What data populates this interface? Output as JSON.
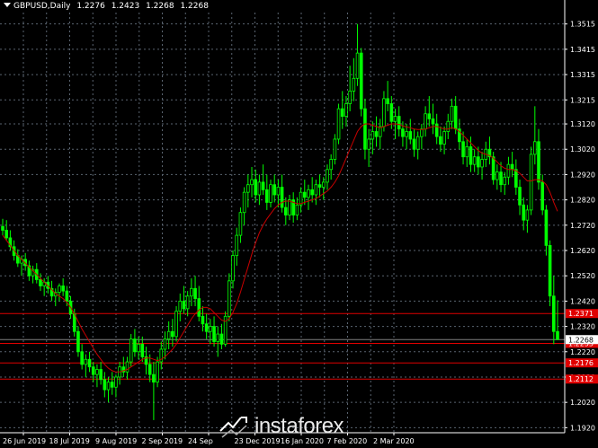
{
  "header": {
    "symbol": "GBPUSD,Daily",
    "open": "1.2276",
    "high": "1.2423",
    "low": "1.2268",
    "close": "1.2268"
  },
  "watermark": {
    "text": "instaforex"
  },
  "chart_data": {
    "type": "candlestick",
    "y_ticks": [
      "1.3515",
      "1.3415",
      "1.3315",
      "1.3215",
      "1.3120",
      "1.3020",
      "1.2920",
      "1.2820",
      "1.2720",
      "1.2620",
      "1.2520",
      "1.2420",
      "1.2320",
      "1.2220",
      "1.2120",
      "1.2020",
      "1.1920"
    ],
    "x_ticks": [
      "26 Jun 2019",
      "18 Jul 2019",
      "9 Aug 2019",
      "2 Sep 2019",
      "24 Sep",
      "23 Dec 2019",
      "16 Jan 2020",
      "7 Feb 2020",
      "2 Mar 2020"
    ],
    "ylim": [
      1.19,
      1.356
    ],
    "levels": [
      {
        "value": 1.2371,
        "label": "1.2371",
        "color": "#e00000"
      },
      {
        "value": 1.2253,
        "label": "1.2253",
        "color": "#e00000"
      },
      {
        "value": 1.2176,
        "label": "1.2176",
        "color": "#e00000"
      },
      {
        "value": 1.2112,
        "label": "1.2112",
        "color": "#e00000"
      }
    ],
    "current_price": {
      "value": 1.2268,
      "label": "1.2268"
    },
    "grid": true,
    "colors": {
      "up": "#00ff00",
      "down": "#00ff00",
      "ma": "#c80000",
      "grid": "#5a6470",
      "level": "#e00000"
    },
    "series": [
      {
        "type": "ohlc",
        "values": [
          [
            1.2715,
            1.2745,
            1.268,
            1.27
          ],
          [
            1.27,
            1.274,
            1.266,
            1.267
          ],
          [
            1.267,
            1.27,
            1.262,
            1.2635
          ],
          [
            1.2635,
            1.266,
            1.258,
            1.26
          ],
          [
            1.26,
            1.2625,
            1.2555,
            1.257
          ],
          [
            1.257,
            1.26,
            1.252,
            1.2585
          ],
          [
            1.2585,
            1.261,
            1.254,
            1.256
          ],
          [
            1.256,
            1.258,
            1.25,
            1.252
          ],
          [
            1.252,
            1.256,
            1.249,
            1.2545
          ],
          [
            1.2545,
            1.257,
            1.249,
            1.2505
          ],
          [
            1.2505,
            1.253,
            1.246,
            1.248
          ],
          [
            1.248,
            1.251,
            1.244,
            1.2495
          ],
          [
            1.2495,
            1.252,
            1.245,
            1.247
          ],
          [
            1.247,
            1.25,
            1.242,
            1.244
          ],
          [
            1.244,
            1.247,
            1.24,
            1.2455
          ],
          [
            1.2455,
            1.249,
            1.242,
            1.248
          ],
          [
            1.248,
            1.251,
            1.244,
            1.246
          ],
          [
            1.246,
            1.248,
            1.24,
            1.242
          ],
          [
            1.242,
            1.244,
            1.235,
            1.237
          ],
          [
            1.237,
            1.239,
            1.228,
            1.23
          ],
          [
            1.23,
            1.232,
            1.22,
            1.222
          ],
          [
            1.222,
            1.225,
            1.215,
            1.217
          ],
          [
            1.217,
            1.221,
            1.212,
            1.219
          ],
          [
            1.219,
            1.222,
            1.214,
            1.216
          ],
          [
            1.216,
            1.218,
            1.21,
            1.213
          ],
          [
            1.213,
            1.217,
            1.208,
            1.215
          ],
          [
            1.215,
            1.218,
            1.209,
            1.211
          ],
          [
            1.211,
            1.214,
            1.204,
            1.207
          ],
          [
            1.207,
            1.212,
            1.202,
            1.21
          ],
          [
            1.21,
            1.214,
            1.205,
            1.208
          ],
          [
            1.208,
            1.213,
            1.204,
            1.212
          ],
          [
            1.212,
            1.218,
            1.209,
            1.216
          ],
          [
            1.216,
            1.22,
            1.212,
            1.214
          ],
          [
            1.214,
            1.22,
            1.211,
            1.218
          ],
          [
            1.218,
            1.229,
            1.216,
            1.227
          ],
          [
            1.227,
            1.231,
            1.22,
            1.222
          ],
          [
            1.222,
            1.228,
            1.219,
            1.225
          ],
          [
            1.225,
            1.228,
            1.218,
            1.22
          ],
          [
            1.22,
            1.224,
            1.213,
            1.217
          ],
          [
            1.217,
            1.221,
            1.21,
            1.213
          ],
          [
            1.213,
            1.218,
            1.195,
            1.21
          ],
          [
            1.21,
            1.22,
            1.208,
            1.218
          ],
          [
            1.218,
            1.226,
            1.215,
            1.223
          ],
          [
            1.223,
            1.23,
            1.219,
            1.227
          ],
          [
            1.227,
            1.234,
            1.223,
            1.23
          ],
          [
            1.23,
            1.235,
            1.224,
            1.228
          ],
          [
            1.228,
            1.24,
            1.226,
            1.238
          ],
          [
            1.238,
            1.245,
            1.234,
            1.242
          ],
          [
            1.242,
            1.248,
            1.237,
            1.239
          ],
          [
            1.239,
            1.246,
            1.236,
            1.244
          ],
          [
            1.244,
            1.251,
            1.24,
            1.247
          ],
          [
            1.247,
            1.252,
            1.24,
            1.243
          ],
          [
            1.243,
            1.248,
            1.234,
            1.236
          ],
          [
            1.236,
            1.24,
            1.23,
            1.233
          ],
          [
            1.233,
            1.237,
            1.227,
            1.23
          ],
          [
            1.23,
            1.235,
            1.225,
            1.232
          ],
          [
            1.232,
            1.236,
            1.224,
            1.226
          ],
          [
            1.226,
            1.232,
            1.22,
            1.229
          ],
          [
            1.229,
            1.233,
            1.223,
            1.225
          ],
          [
            1.225,
            1.238,
            1.224,
            1.236
          ],
          [
            1.236,
            1.253,
            1.234,
            1.25
          ],
          [
            1.25,
            1.262,
            1.247,
            1.26
          ],
          [
            1.26,
            1.271,
            1.256,
            1.268
          ],
          [
            1.268,
            1.279,
            1.265,
            1.277
          ],
          [
            1.277,
            1.287,
            1.272,
            1.285
          ],
          [
            1.285,
            1.292,
            1.279,
            1.288
          ],
          [
            1.288,
            1.295,
            1.283,
            1.29
          ],
          [
            1.29,
            1.294,
            1.281,
            1.284
          ],
          [
            1.284,
            1.292,
            1.28,
            1.289
          ],
          [
            1.289,
            1.296,
            1.284,
            1.286
          ],
          [
            1.286,
            1.292,
            1.278,
            1.281
          ],
          [
            1.281,
            1.29,
            1.279,
            1.288
          ],
          [
            1.288,
            1.292,
            1.281,
            1.284
          ],
          [
            1.284,
            1.29,
            1.279,
            1.287
          ],
          [
            1.287,
            1.292,
            1.277,
            1.279
          ],
          [
            1.279,
            1.283,
            1.272,
            1.276
          ],
          [
            1.276,
            1.284,
            1.274,
            1.282
          ],
          [
            1.282,
            1.285,
            1.273,
            1.276
          ],
          [
            1.276,
            1.283,
            1.274,
            1.28
          ],
          [
            1.28,
            1.287,
            1.277,
            1.285
          ],
          [
            1.285,
            1.29,
            1.28,
            1.283
          ],
          [
            1.283,
            1.288,
            1.278,
            1.286
          ],
          [
            1.286,
            1.291,
            1.281,
            1.284
          ],
          [
            1.284,
            1.29,
            1.28,
            1.288
          ],
          [
            1.288,
            1.292,
            1.283,
            1.287
          ],
          [
            1.287,
            1.291,
            1.282,
            1.289
          ],
          [
            1.289,
            1.296,
            1.286,
            1.294
          ],
          [
            1.294,
            1.3,
            1.29,
            1.298
          ],
          [
            1.298,
            1.308,
            1.296,
            1.306
          ],
          [
            1.306,
            1.32,
            1.304,
            1.318
          ],
          [
            1.318,
            1.325,
            1.31,
            1.315
          ],
          [
            1.315,
            1.323,
            1.311,
            1.32
          ],
          [
            1.32,
            1.335,
            1.317,
            1.325
          ],
          [
            1.325,
            1.338,
            1.321,
            1.33
          ],
          [
            1.33,
            1.3515,
            1.327,
            1.34
          ],
          [
            1.34,
            1.342,
            1.315,
            1.318
          ],
          [
            1.318,
            1.322,
            1.298,
            1.302
          ],
          [
            1.302,
            1.31,
            1.295,
            1.306
          ],
          [
            1.306,
            1.313,
            1.3,
            1.309
          ],
          [
            1.309,
            1.315,
            1.303,
            1.307
          ],
          [
            1.307,
            1.314,
            1.302,
            1.311
          ],
          [
            1.311,
            1.325,
            1.309,
            1.322
          ],
          [
            1.322,
            1.329,
            1.317,
            1.32
          ],
          [
            1.32,
            1.323,
            1.31,
            1.313
          ],
          [
            1.313,
            1.318,
            1.306,
            1.315
          ],
          [
            1.315,
            1.319,
            1.307,
            1.31
          ],
          [
            1.31,
            1.313,
            1.303,
            1.307
          ],
          [
            1.307,
            1.312,
            1.302,
            1.309
          ],
          [
            1.309,
            1.314,
            1.304,
            1.306
          ],
          [
            1.306,
            1.31,
            1.299,
            1.302
          ],
          [
            1.302,
            1.309,
            1.298,
            1.307
          ],
          [
            1.307,
            1.312,
            1.302,
            1.31
          ],
          [
            1.31,
            1.319,
            1.307,
            1.316
          ],
          [
            1.316,
            1.323,
            1.311,
            1.314
          ],
          [
            1.314,
            1.32,
            1.308,
            1.312
          ],
          [
            1.312,
            1.316,
            1.304,
            1.307
          ],
          [
            1.307,
            1.311,
            1.301,
            1.304
          ],
          [
            1.304,
            1.311,
            1.3,
            1.309
          ],
          [
            1.309,
            1.316,
            1.306,
            1.313
          ],
          [
            1.313,
            1.322,
            1.31,
            1.319
          ],
          [
            1.319,
            1.323,
            1.308,
            1.31
          ],
          [
            1.31,
            1.314,
            1.302,
            1.305
          ],
          [
            1.305,
            1.309,
            1.296,
            1.299
          ],
          [
            1.299,
            1.306,
            1.295,
            1.303
          ],
          [
            1.303,
            1.307,
            1.293,
            1.296
          ],
          [
            1.296,
            1.302,
            1.293,
            1.299
          ],
          [
            1.299,
            1.303,
            1.292,
            1.295
          ],
          [
            1.295,
            1.301,
            1.29,
            1.298
          ],
          [
            1.298,
            1.305,
            1.295,
            1.302
          ],
          [
            1.302,
            1.307,
            1.296,
            1.299
          ],
          [
            1.299,
            1.301,
            1.288,
            1.29
          ],
          [
            1.29,
            1.296,
            1.286,
            1.293
          ],
          [
            1.293,
            1.297,
            1.285,
            1.288
          ],
          [
            1.288,
            1.293,
            1.284,
            1.291
          ],
          [
            1.291,
            1.299,
            1.288,
            1.296
          ],
          [
            1.296,
            1.301,
            1.291,
            1.294
          ],
          [
            1.294,
            1.298,
            1.284,
            1.287
          ],
          [
            1.287,
            1.29,
            1.276,
            1.28
          ],
          [
            1.28,
            1.283,
            1.27,
            1.274
          ],
          [
            1.274,
            1.28,
            1.269,
            1.278
          ],
          [
            1.278,
            1.303,
            1.276,
            1.3
          ],
          [
            1.3,
            1.319,
            1.296,
            1.305
          ],
          [
            1.305,
            1.31,
            1.286,
            1.289
          ],
          [
            1.289,
            1.292,
            1.276,
            1.278
          ],
          [
            1.278,
            1.28,
            1.26,
            1.264
          ],
          [
            1.264,
            1.266,
            1.24,
            1.244
          ],
          [
            1.244,
            1.252,
            1.225,
            1.23
          ],
          [
            1.23,
            1.2423,
            1.2268,
            1.2268
          ]
        ]
      },
      {
        "type": "ma",
        "values": [
          1.268,
          1.266,
          1.264,
          1.262,
          1.26,
          1.2585,
          1.257,
          1.2555,
          1.254,
          1.2525,
          1.251,
          1.2495,
          1.248,
          1.2465,
          1.245,
          1.244,
          1.243,
          1.2415,
          1.2395,
          1.237,
          1.234,
          1.231,
          1.2285,
          1.226,
          1.2235,
          1.221,
          1.219,
          1.217,
          1.2155,
          1.2145,
          1.214,
          1.214,
          1.2145,
          1.215,
          1.216,
          1.217,
          1.218,
          1.219,
          1.2195,
          1.2195,
          1.219,
          1.2185,
          1.219,
          1.22,
          1.2215,
          1.223,
          1.225,
          1.2275,
          1.23,
          1.2325,
          1.235,
          1.237,
          1.2385,
          1.2395,
          1.2395,
          1.239,
          1.2375,
          1.236,
          1.2345,
          1.234,
          1.235,
          1.2375,
          1.241,
          1.2455,
          1.2505,
          1.2555,
          1.2605,
          1.265,
          1.269,
          1.272,
          1.2745,
          1.2765,
          1.2785,
          1.28,
          1.281,
          1.2815,
          1.2815,
          1.281,
          1.2805,
          1.2805,
          1.281,
          1.2815,
          1.282,
          1.2825,
          1.2835,
          1.2845,
          1.2855,
          1.287,
          1.289,
          1.2915,
          1.295,
          1.2985,
          1.302,
          1.3055,
          1.309,
          1.311,
          1.312,
          1.312,
          1.3115,
          1.311,
          1.3105,
          1.311,
          1.3115,
          1.312,
          1.312,
          1.3118,
          1.3112,
          1.3108,
          1.3105,
          1.31,
          1.3098,
          1.3098,
          1.31,
          1.3105,
          1.311,
          1.311,
          1.3105,
          1.31,
          1.31,
          1.3105,
          1.31,
          1.309,
          1.3075,
          1.306,
          1.3045,
          1.303,
          1.3015,
          1.3005,
          1.3,
          1.2995,
          1.2985,
          1.297,
          1.2955,
          1.2945,
          1.294,
          1.294,
          1.2935,
          1.2925,
          1.291,
          1.2895,
          1.2895,
          1.29,
          1.29,
          1.2895,
          1.288,
          1.285,
          1.281,
          1.2775
        ]
      }
    ]
  }
}
